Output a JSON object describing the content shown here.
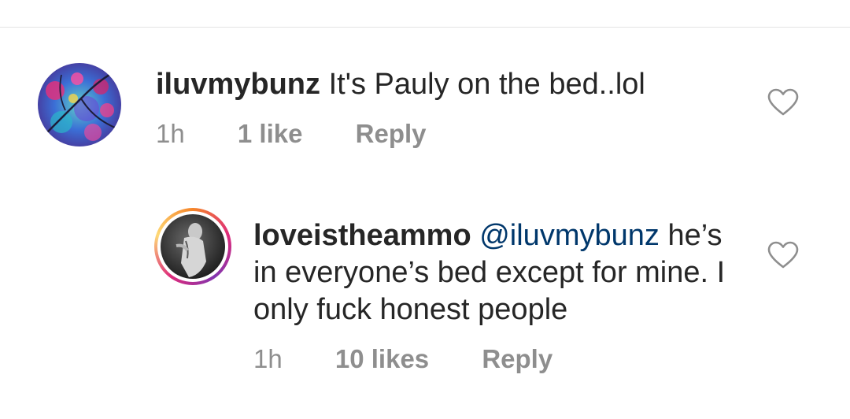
{
  "comments": [
    {
      "username": "iluvmybunz",
      "mention": "",
      "text": "It's Pauly on the bed..lol",
      "time": "1h",
      "likes": "1 like",
      "reply_label": "Reply",
      "avatar_icon": "abstract-art-avatar",
      "like_icon": "heart-outline-icon"
    },
    {
      "username": "loveistheammo",
      "mention": "@iluvmybunz",
      "text": "he’s in everyone’s bed except for mine. I only fuck honest people",
      "time": "1h",
      "likes": "10 likes",
      "reply_label": "Reply",
      "avatar_icon": "story-ring-photo-avatar",
      "like_icon": "heart-outline-icon"
    }
  ],
  "colors": {
    "text": "#262626",
    "muted": "#8e8e8e",
    "mention": "#00376b",
    "story_ring": [
      "#f58529",
      "#dd2a7b",
      "#8134af"
    ]
  }
}
